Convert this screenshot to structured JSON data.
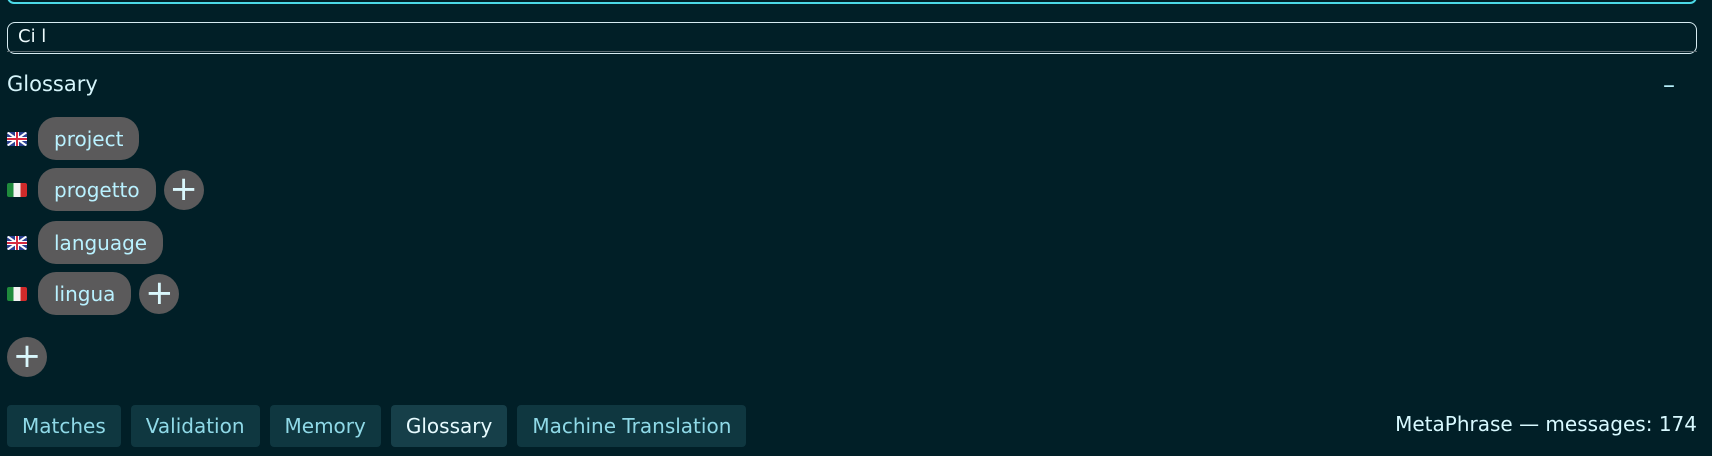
{
  "top_fields": {
    "second_value": "Ci l"
  },
  "panel": {
    "title": "Glossary",
    "collapse_symbol": "–"
  },
  "entries": [
    {
      "source": {
        "flag": "uk-flag",
        "term": "project"
      },
      "target": {
        "flag": "italy-flag",
        "term": "progetto",
        "add_symbol": "+"
      }
    },
    {
      "source": {
        "flag": "uk-flag",
        "term": "language"
      },
      "target": {
        "flag": "italy-flag",
        "term": "lingua",
        "add_symbol": "+"
      }
    }
  ],
  "add_entry_symbol": "+",
  "tabs": [
    {
      "label": "Matches",
      "active": false
    },
    {
      "label": "Validation",
      "active": false
    },
    {
      "label": "Memory",
      "active": false
    },
    {
      "label": "Glossary",
      "active": true
    },
    {
      "label": "Machine Translation",
      "active": false
    }
  ],
  "status": {
    "text": "MetaPhrase — messages: 174"
  },
  "colors": {
    "background": "#011f27",
    "accent": "#4bd9e6",
    "chip": "#5b5a5b",
    "tab": "#0f3740",
    "tab_active": "#163f49"
  }
}
